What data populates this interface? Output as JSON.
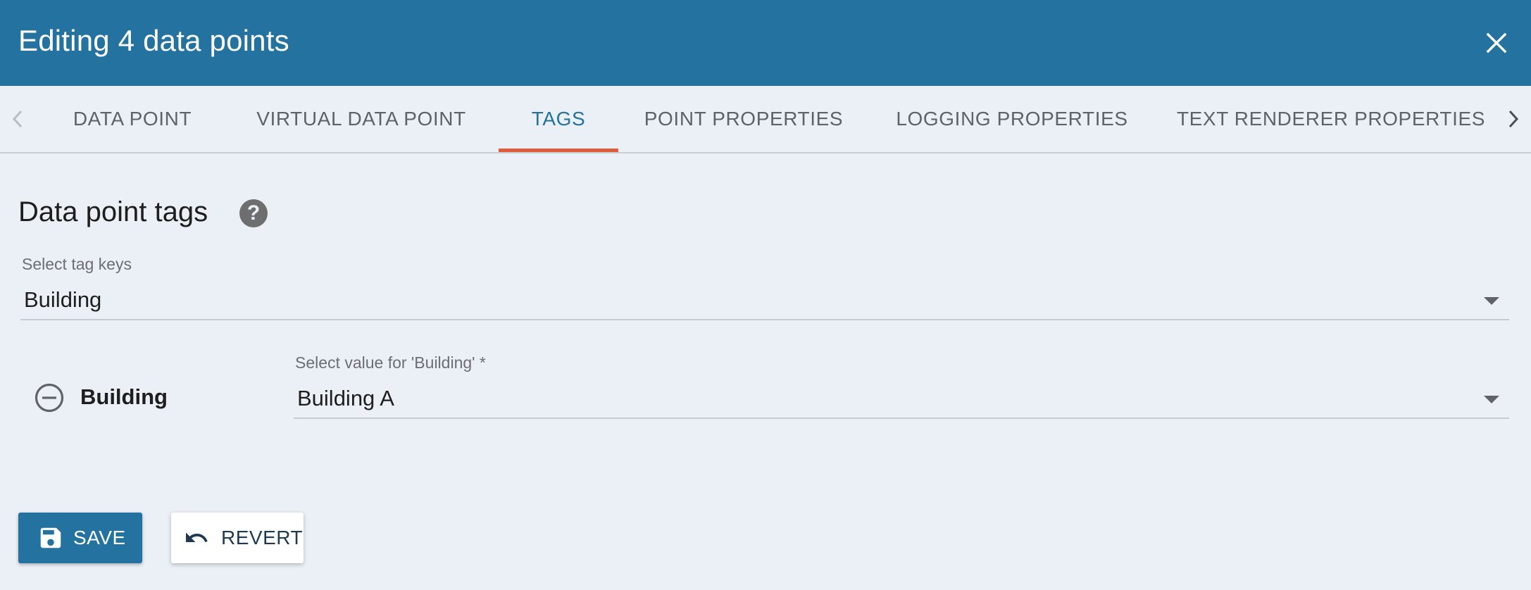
{
  "dialog": {
    "title": "Editing 4 data points",
    "close_icon": "close-icon",
    "colors": {
      "header": "#23729f",
      "active_tab": "#23729f",
      "tab_indicator": "#e05a3b",
      "background": "#eaf0f6"
    }
  },
  "tabs": [
    {
      "label": "DATA POINT",
      "active": false
    },
    {
      "label": "VIRTUAL DATA POINT",
      "active": false
    },
    {
      "label": "TAGS",
      "active": true
    },
    {
      "label": "POINT PROPERTIES",
      "active": false
    },
    {
      "label": "LOGGING PROPERTIES",
      "active": false
    },
    {
      "label": "TEXT RENDERER PROPERTIES",
      "active": false
    }
  ],
  "tab_nav": {
    "prev_icon": "chevron-left-icon",
    "next_icon": "chevron-right-icon"
  },
  "section": {
    "title": "Data point tags",
    "help_glyph": "?",
    "help_icon": "help-icon"
  },
  "tag_keys_select": {
    "label": "Select tag keys",
    "value": "Building"
  },
  "tag_rows": [
    {
      "key": "Building",
      "value_label": "Select value for 'Building' *",
      "value": "Building A",
      "remove_icon": "remove-circle-icon"
    }
  ],
  "actions": {
    "save_label": "SAVE",
    "save_icon": "save-icon",
    "revert_label": "REVERT",
    "revert_icon": "undo-icon"
  }
}
